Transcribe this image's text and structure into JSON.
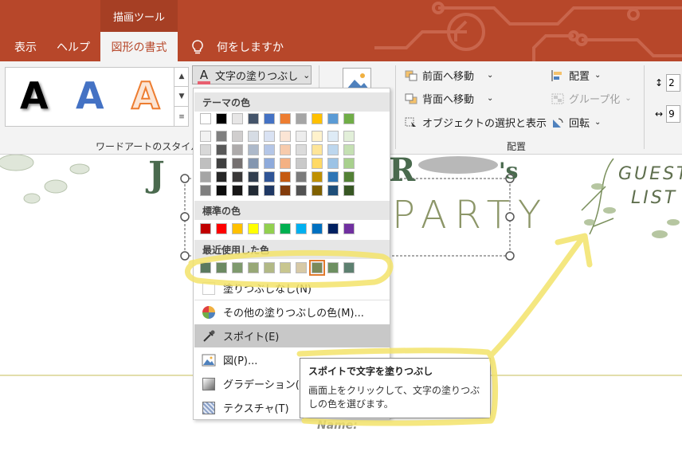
{
  "context_tab": "描画ツール",
  "tabs": [
    {
      "label": "表示"
    },
    {
      "label": "ヘルプ"
    },
    {
      "label": "図形の書式"
    },
    {
      "label": "何をしますか"
    }
  ],
  "wordart": {
    "letters": [
      "A",
      "A",
      "A"
    ],
    "group_label": "ワードアートのスタイル"
  },
  "text_fill_button": {
    "icon_letter": "A",
    "label": "文字の塗りつぶし",
    "arrow": "⌄"
  },
  "arrange": {
    "bring_forward": "前面へ移動",
    "send_backward": "背面へ移動",
    "selection_pane": "オブジェクトの選択と表示",
    "align": "配置",
    "group": "グループ化",
    "rotate": "回転",
    "group_label": "配置"
  },
  "size": {
    "height_value": "2",
    "width_value": "9"
  },
  "menu": {
    "theme_header": "テーマの色",
    "standard_header": "標準の色",
    "recent_header": "最近使用した色",
    "no_fill": "塗りつぶしなし(N)",
    "more_colors": "その他の塗りつぶしの色(M)...",
    "eyedropper": "スポイト(E)",
    "picture": "図(P)...",
    "gradient": "グラデーション(G)",
    "texture": "テクスチャ(T)"
  },
  "theme_top": [
    "#ffffff",
    "#000000",
    "#e7e6e6",
    "#44546a",
    "#4472c4",
    "#ed7d31",
    "#a5a5a5",
    "#ffc000",
    "#5b9bd5",
    "#70ad47"
  ],
  "theme_shades": [
    [
      "#f2f2f2",
      "#7f7f7f",
      "#d0cece",
      "#d6dce4",
      "#d9e2f3",
      "#fbe5d5",
      "#ededed",
      "#fff2cc",
      "#deebf6",
      "#e2efd9"
    ],
    [
      "#d8d8d8",
      "#595959",
      "#aeabab",
      "#adb9ca",
      "#b4c6e7",
      "#f7cbac",
      "#dbdbdb",
      "#fee599",
      "#bdd7ee",
      "#c5e0b3"
    ],
    [
      "#bfbfbf",
      "#3f3f3f",
      "#757070",
      "#8496b0",
      "#8eaadb",
      "#f4b183",
      "#c9c9c9",
      "#ffd965",
      "#9cc3e5",
      "#a8d08d"
    ],
    [
      "#a5a5a5",
      "#262626",
      "#3a3838",
      "#323f4f",
      "#2f5496",
      "#c55a11",
      "#7b7b7b",
      "#bf9000",
      "#2e75b5",
      "#538135"
    ],
    [
      "#7f7f7f",
      "#0c0c0c",
      "#171616",
      "#222a35",
      "#1f3864",
      "#833c0b",
      "#525252",
      "#7f6000",
      "#1e4e79",
      "#375623"
    ]
  ],
  "standard_colors": [
    "#c00000",
    "#ff0000",
    "#ffc000",
    "#ffff00",
    "#92d050",
    "#00b050",
    "#00b0f0",
    "#0070c0",
    "#002060",
    "#7030a0"
  ],
  "recent_colors": [
    "#5b7a5f",
    "#6c8a62",
    "#7f9a6e",
    "#98a877",
    "#b2b986",
    "#c8c68f",
    "#d7c9a6",
    "#7b8a5a",
    "#6d8f61",
    "#5d8070"
  ],
  "tooltip": {
    "title": "スポイトで文字を塗りつぶし",
    "desc": "画面上をクリックして、文字の塗りつぶしの色を選びます。"
  },
  "slide": {
    "title_left": "J",
    "title_right": "'s",
    "party": "PARTY",
    "guest": "GUEST",
    "list": "LIST",
    "name": "Name:"
  }
}
